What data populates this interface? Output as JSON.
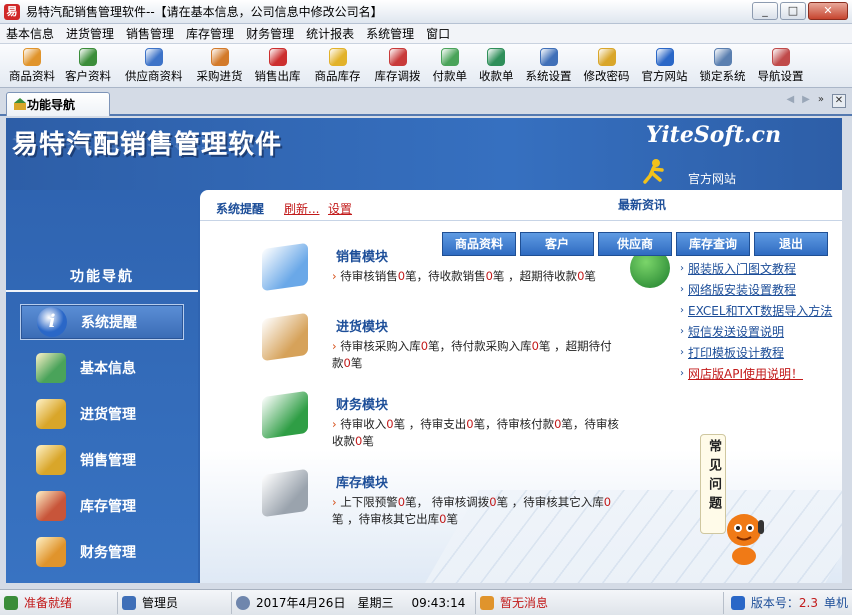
{
  "window": {
    "title": "易特汽配销售管理软件--【请在基本信息，公司信息中修改公司名】",
    "app_icon_glyph": "易"
  },
  "menubar": {
    "items": [
      "基本信息",
      "进货管理",
      "销售管理",
      "库存管理",
      "财务管理",
      "统计报表",
      "系统管理",
      "窗口"
    ]
  },
  "toolbar": {
    "items": [
      {
        "label": "商品资料",
        "icon": "product-icon",
        "color": "#e0942c"
      },
      {
        "label": "客户资料",
        "icon": "customers-icon",
        "color": "#3b8d3a"
      },
      {
        "label": "供应商资料",
        "icon": "suppliers-icon",
        "color": "#3d73c8"
      },
      {
        "label": "采购进货",
        "icon": "purchase-icon",
        "color": "#d37a2a"
      },
      {
        "label": "销售出库",
        "icon": "sales-icon",
        "color": "#cc2f2f"
      },
      {
        "label": "商品库存",
        "icon": "stock-icon",
        "color": "#e2b22a"
      },
      {
        "label": "库存调拨",
        "icon": "transfer-icon",
        "color": "#c83a3a"
      },
      {
        "label": "付款单",
        "icon": "payment-icon",
        "color": "#4aa35a"
      },
      {
        "label": "收款单",
        "icon": "receipt-icon",
        "color": "#2f8f5a"
      },
      {
        "label": "系统设置",
        "icon": "settings-icon",
        "color": "#3f6fb8"
      },
      {
        "label": "修改密码",
        "icon": "password-icon",
        "color": "#d9a62a"
      },
      {
        "label": "官方网站",
        "icon": "ie-icon",
        "color": "#2a67c7"
      },
      {
        "label": "锁定系统",
        "icon": "lock-icon",
        "color": "#5a7fb0"
      },
      {
        "label": "导航设置",
        "icon": "nav-settings-icon",
        "color": "#c04a4a"
      }
    ]
  },
  "tab": {
    "label": "功能导航"
  },
  "banner": {
    "title": "易特汽配销售管理软件",
    "logo": "YiteSoft.cn",
    "home_link": "官方网站"
  },
  "leftnav": {
    "title": "功能导航",
    "items": [
      {
        "label": "系统提醒",
        "icon": "info-icon",
        "active": true
      },
      {
        "label": "基本信息",
        "icon": "cubes-icon",
        "active": false
      },
      {
        "label": "进货管理",
        "icon": "box-in-icon",
        "active": false
      },
      {
        "label": "销售管理",
        "icon": "box-out-icon",
        "active": false
      },
      {
        "label": "库存管理",
        "icon": "warehouse-icon",
        "active": false
      },
      {
        "label": "财务管理",
        "icon": "finance-icon",
        "active": false
      }
    ]
  },
  "panel": {
    "tips_label": "系统提醒",
    "refresh_link": "刷新...",
    "settings_link": "设置",
    "news_label": "最新资讯",
    "quick_buttons": [
      "商品资料",
      "客户",
      "供应商",
      "库存查询",
      "退出"
    ],
    "modules": [
      {
        "title": "销售模块",
        "icon": "sales-book-icon",
        "parts": [
          "待审核销售",
          "0",
          "笔，待收款销售",
          "0",
          "笔 ，超期待收款",
          "0",
          "笔"
        ]
      },
      {
        "title": "进货模块",
        "icon": "purchase-box-icon",
        "parts": [
          "待审核采购入库",
          "0",
          "笔，待付款采购入库",
          "0",
          "笔 ，超期待付款",
          "0",
          "笔"
        ]
      },
      {
        "title": "财务模块",
        "icon": "dollar-arrow-icon",
        "parts": [
          "待审收入",
          "0",
          "笔 ，待审支出",
          "0",
          "笔，待审核付款",
          "0",
          "笔，待审核收款",
          "0",
          "笔"
        ]
      },
      {
        "title": "库存模块",
        "icon": "coins-stack-icon",
        "parts": [
          "上下限预警",
          "0",
          "笔，  待审核调拨",
          "0",
          "笔 ，待审核其它入库",
          "0",
          "笔  ，待审核其它出库",
          "0",
          "笔"
        ]
      }
    ],
    "news": [
      {
        "text": "服装版入门图文教程",
        "red": false
      },
      {
        "text": "网络版安装设置教程",
        "red": false
      },
      {
        "text": "EXCEL和TXT数据导入方法",
        "red": false
      },
      {
        "text": "短信发送设置说明",
        "red": false
      },
      {
        "text": "打印模板设计教程",
        "red": false
      },
      {
        "text": "网店版API使用说明！",
        "red": true
      }
    ],
    "faq_label": "常见问题"
  },
  "statusbar": {
    "ready": "准备就绪",
    "user": "管理员",
    "date": "2017年4月26日",
    "weekday": "星期三",
    "time": "09:43:14",
    "messages": "暂无消息",
    "version_label": "版本号：",
    "version": "2.3",
    "mode": "单机"
  },
  "colors": {
    "accent_blue": "#2f64b1",
    "link_red": "#c21a1a",
    "title_blue": "#1e4f99"
  }
}
